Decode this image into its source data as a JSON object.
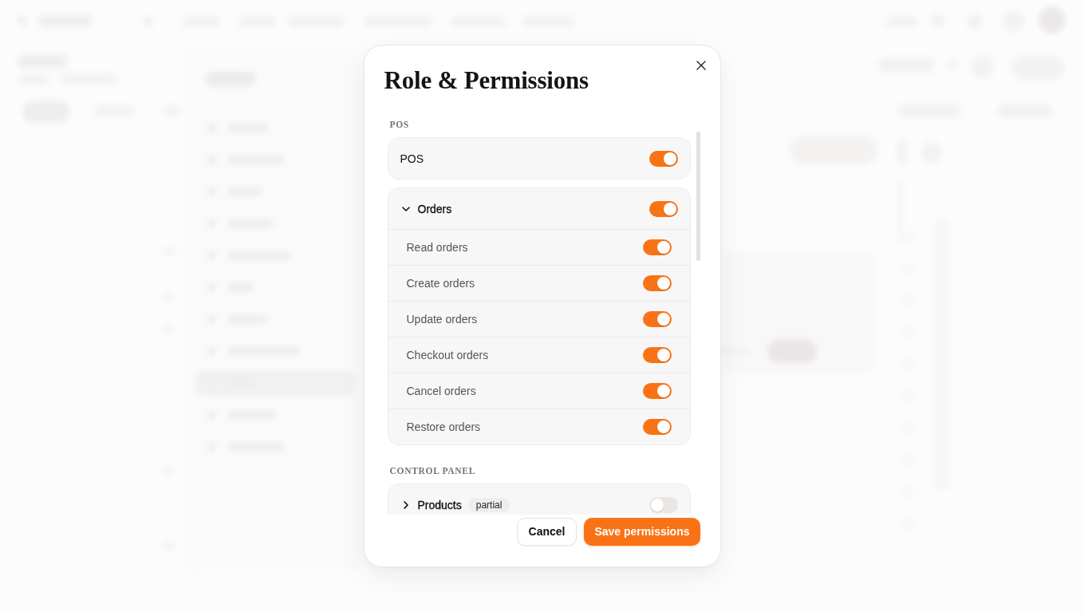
{
  "dialog": {
    "title": "Role & Permissions",
    "sections": [
      {
        "heading": "POS",
        "groups": [
          {
            "kind": "toggle",
            "label": "POS",
            "on": true
          },
          {
            "kind": "group",
            "label": "Orders",
            "expanded": true,
            "on": true,
            "permissions": [
              {
                "label": "Read orders",
                "on": true
              },
              {
                "label": "Create orders",
                "on": true
              },
              {
                "label": "Update orders",
                "on": true
              },
              {
                "label": "Checkout orders",
                "on": true
              },
              {
                "label": "Cancel orders",
                "on": true
              },
              {
                "label": "Restore orders",
                "on": true
              }
            ]
          }
        ]
      },
      {
        "heading": "CONTROL PANEL",
        "groups": [
          {
            "kind": "group",
            "label": "Products",
            "badge": "partial",
            "expanded": false,
            "on": false
          }
        ]
      }
    ],
    "buttons": [
      {
        "kind": "secondary",
        "label": "Cancel"
      },
      {
        "kind": "primary",
        "label": "Save permissions"
      }
    ]
  }
}
